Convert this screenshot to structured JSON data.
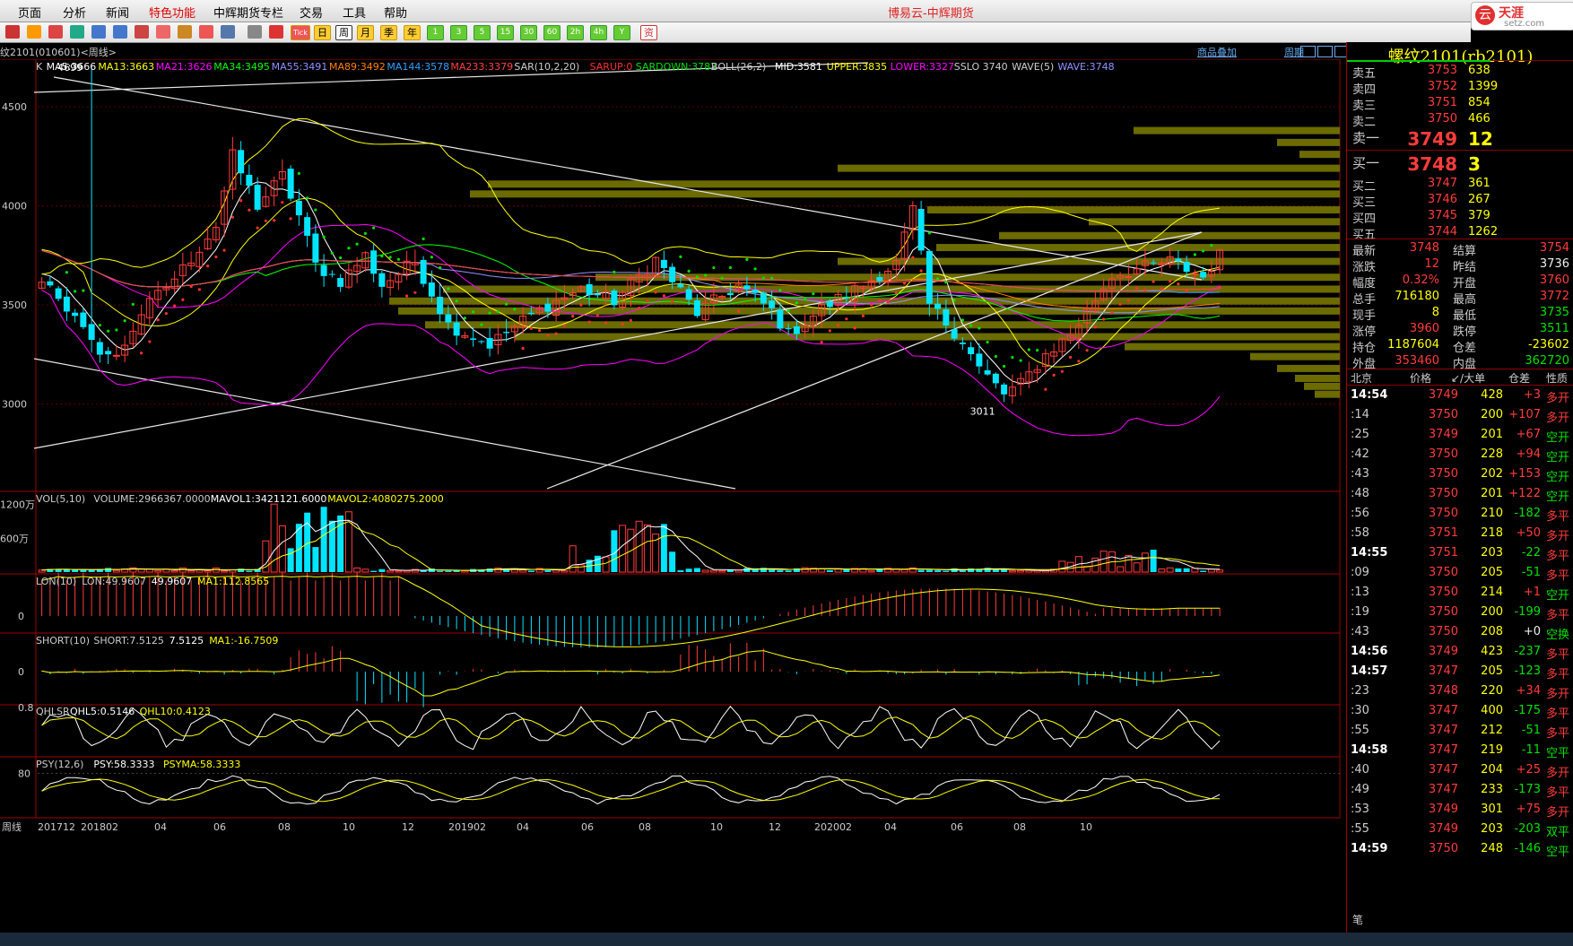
{
  "app": {
    "title": "博易云-中辉期货",
    "menu": [
      "页面",
      "分析",
      "新闻",
      "特色功能",
      "中辉期货专栏",
      "交易",
      "工具",
      "帮助"
    ],
    "menu_hot_index": 3,
    "logo_text": "天涯",
    "logo_sub": "setz.com",
    "toolbar_labels": {
      "week": "周",
      "month": "月",
      "quarter": "季",
      "year": "年",
      "day": "日",
      "tick": "Tick",
      "m1": "1",
      "m3": "3",
      "m5": "5",
      "m15": "15",
      "m30": "30",
      "m60": "60",
      "custom": "2h",
      "hour": "4h",
      "y": "Y",
      "news": "资"
    }
  },
  "chart_header": {
    "breadcrumb": "纹2101(010601)<周线>",
    "product_add": "商品叠加",
    "period_link": "周期"
  },
  "indicators": {
    "main": [
      {
        "t": "K",
        "c": "#ccc"
      },
      {
        "t": "MA5:3666",
        "c": "#ffffff"
      },
      {
        "t": "MA13:3663",
        "c": "#ffff00"
      },
      {
        "t": "MA21:3626",
        "c": "#ff00ff"
      },
      {
        "t": "MA34:3495",
        "c": "#00ff00"
      },
      {
        "t": "MA55:3491",
        "c": "#9090ff"
      },
      {
        "t": "MA89:3492",
        "c": "#ff8000"
      },
      {
        "t": "MA144:3578",
        "c": "#30a0ff"
      },
      {
        "t": "MA233:3379",
        "c": "#ff4040"
      },
      {
        "t": "SAR(10,2,20)",
        "c": "#ccc"
      },
      {
        "t": "SARUP:0",
        "c": "#ff3030"
      },
      {
        "t": "SARDOWN:3782",
        "c": "#00e000"
      },
      {
        "t": "BOLL(26,2)",
        "c": "#ccc"
      },
      {
        "t": "MID:3581",
        "c": "#ffffff"
      },
      {
        "t": "UPPER:3835",
        "c": "#ffff00"
      },
      {
        "t": "LOWER:3327",
        "c": "#ff00ff"
      },
      {
        "t": "SSLO 3740",
        "c": "#ccc"
      },
      {
        "t": "WAVE(5)",
        "c": "#ccc"
      },
      {
        "t": "WAVE:3748",
        "c": "#9090ff"
      }
    ],
    "vol": [
      {
        "t": "VOL(5,10)",
        "c": "#ccc"
      },
      {
        "t": "VOLUME:2966367.0000",
        "c": "#ccc"
      },
      {
        "t": "MAVOL1:3421121.6000",
        "c": "#ffffff"
      },
      {
        "t": "MAVOL2:4080275.2000",
        "c": "#ffff00"
      }
    ],
    "lon": [
      {
        "t": "LON(10)",
        "c": "#ccc"
      },
      {
        "t": "LON:49.9607",
        "c": "#ccc"
      },
      {
        "t": "49.9607",
        "c": "#ffffff"
      },
      {
        "t": "MA1:112.8565",
        "c": "#ffff00"
      }
    ],
    "short": [
      {
        "t": "SHORT(10)",
        "c": "#ccc"
      },
      {
        "t": "SHORT:7.5125",
        "c": "#ccc"
      },
      {
        "t": "7.5125",
        "c": "#ffffff"
      },
      {
        "t": "MA1:-16.7509",
        "c": "#ffff00"
      }
    ],
    "qhlsr": [
      {
        "t": "QHLSR",
        "c": "#ccc"
      },
      {
        "t": "QHL5:0.5146",
        "c": "#ffffff"
      },
      {
        "t": "QHL10:0.4123",
        "c": "#ffff00"
      }
    ],
    "psy": [
      {
        "t": "PSY(12,6)",
        "c": "#ccc"
      },
      {
        "t": "PSY:58.3333",
        "c": "#ffffff"
      },
      {
        "t": "PSYMA:58.3333",
        "c": "#ffff00"
      }
    ]
  },
  "axes": {
    "price_ticks": [
      "4500",
      "4000",
      "3500",
      "3000"
    ],
    "vol_ticks": [
      "1200万",
      "600万"
    ],
    "lon_tick": "0",
    "short_tick": "0",
    "qhlsr_tick": "0.8",
    "psy_tick": "80",
    "x_start_label": "周线",
    "x_labels": [
      "201712",
      "201802",
      "04",
      "06",
      "08",
      "10",
      "12",
      "201902",
      "04",
      "06",
      "08",
      "10",
      "12",
      "202002",
      "04",
      "06",
      "08",
      "10"
    ],
    "max_label": "4699",
    "min_label": "3011"
  },
  "chart_data": {
    "type": "candlestick",
    "period": "weekly",
    "ylim": [
      2560,
      4740
    ],
    "max": 4699,
    "min": 3011,
    "ma_lines": [
      {
        "name": "MA5",
        "color": "#ffffff"
      },
      {
        "name": "MA13",
        "color": "#ffff00"
      },
      {
        "name": "MA21",
        "color": "#ff00ff"
      },
      {
        "name": "MA34",
        "color": "#00ff00"
      },
      {
        "name": "MA55",
        "color": "#9090ff"
      },
      {
        "name": "MA89",
        "color": "#ff8000"
      },
      {
        "name": "MA144",
        "color": "#30a0ff"
      },
      {
        "name": "MA233",
        "color": "#ff4040"
      }
    ],
    "boll_colors": {
      "mid": "#ffffff",
      "upper": "#ffff00",
      "lower": "#ff00ff"
    }
  },
  "quote": {
    "name": "螺纹2101(rb2101)",
    "asks": [
      {
        "label": "卖五",
        "price": "3753",
        "vol": "638"
      },
      {
        "label": "卖四",
        "price": "3752",
        "vol": "1399"
      },
      {
        "label": "卖三",
        "price": "3751",
        "vol": "854"
      },
      {
        "label": "卖二",
        "price": "3750",
        "vol": "466"
      },
      {
        "label": "卖一",
        "price": "3749",
        "vol": "12"
      }
    ],
    "bids": [
      {
        "label": "买一",
        "price": "3748",
        "vol": "3"
      },
      {
        "label": "买二",
        "price": "3747",
        "vol": "361"
      },
      {
        "label": "买三",
        "price": "3746",
        "vol": "267"
      },
      {
        "label": "买四",
        "price": "3745",
        "vol": "379"
      },
      {
        "label": "买五",
        "price": "3744",
        "vol": "1262"
      }
    ],
    "stats": [
      {
        "l1": "最新",
        "v1": "3748",
        "c1": "red",
        "l2": "结算",
        "v2": "3754",
        "c2": "red"
      },
      {
        "l1": "涨跌",
        "v1": "12",
        "c1": "red",
        "l2": "昨结",
        "v2": "3736",
        "c2": "wht"
      },
      {
        "l1": "幅度",
        "v1": "0.32%",
        "c1": "red",
        "l2": "开盘",
        "v2": "3760",
        "c2": "red"
      },
      {
        "l1": "总手",
        "v1": "716180",
        "c1": "yel",
        "l2": "最高",
        "v2": "3772",
        "c2": "red"
      },
      {
        "l1": "现手",
        "v1": "8",
        "c1": "yel",
        "l2": "最低",
        "v2": "3735",
        "c2": "green"
      },
      {
        "l1": "涨停",
        "v1": "3960",
        "c1": "red",
        "l2": "跌停",
        "v2": "3511",
        "c2": "green"
      },
      {
        "l1": "持仓",
        "v1": "1187604",
        "c1": "yel",
        "l2": "仓差",
        "v2": "-23602",
        "c2": "yel"
      },
      {
        "l1": "外盘",
        "v1": "353460",
        "c1": "red",
        "l2": "内盘",
        "v2": "362720",
        "c2": "green"
      }
    ],
    "tick_header": [
      "北京",
      "价格",
      "↙/大单",
      "仓差",
      "性质"
    ],
    "ticks": [
      {
        "t": "14:54",
        "major": true,
        "p": "3749",
        "q": "428",
        "d": "+3",
        "n": "多开",
        "dc": "red",
        "nc": "red"
      },
      {
        "t": ":14",
        "major": false,
        "p": "3750",
        "q": "200",
        "d": "+107",
        "n": "多开",
        "dc": "red",
        "nc": "red"
      },
      {
        "t": ":25",
        "major": false,
        "p": "3749",
        "q": "201",
        "d": "+67",
        "n": "空开",
        "dc": "red",
        "nc": "green"
      },
      {
        "t": ":42",
        "major": false,
        "p": "3750",
        "q": "228",
        "d": "+94",
        "n": "空开",
        "dc": "red",
        "nc": "green"
      },
      {
        "t": ":43",
        "major": false,
        "p": "3750",
        "q": "202",
        "d": "+153",
        "n": "空开",
        "dc": "red",
        "nc": "green"
      },
      {
        "t": ":48",
        "major": false,
        "p": "3750",
        "q": "201",
        "d": "+122",
        "n": "空开",
        "dc": "red",
        "nc": "green"
      },
      {
        "t": ":56",
        "major": false,
        "p": "3750",
        "q": "210",
        "d": "-182",
        "n": "多平",
        "dc": "green",
        "nc": "red"
      },
      {
        "t": ":58",
        "major": false,
        "p": "3751",
        "q": "218",
        "d": "+50",
        "n": "多开",
        "dc": "red",
        "nc": "red"
      },
      {
        "t": "14:55",
        "major": true,
        "p": "3751",
        "q": "203",
        "d": "-22",
        "n": "多平",
        "dc": "green",
        "nc": "red"
      },
      {
        "t": ":09",
        "major": false,
        "p": "3750",
        "q": "205",
        "d": "-51",
        "n": "多平",
        "dc": "green",
        "nc": "red"
      },
      {
        "t": ":13",
        "major": false,
        "p": "3750",
        "q": "214",
        "d": "+1",
        "n": "空开",
        "dc": "red",
        "nc": "green"
      },
      {
        "t": ":19",
        "major": false,
        "p": "3750",
        "q": "200",
        "d": "-199",
        "n": "多平",
        "dc": "green",
        "nc": "red"
      },
      {
        "t": ":43",
        "major": false,
        "p": "3750",
        "q": "208",
        "d": "+0",
        "n": "空换",
        "dc": "wht",
        "nc": "green"
      },
      {
        "t": "14:56",
        "major": true,
        "p": "3749",
        "q": "423",
        "d": "-237",
        "n": "多平",
        "dc": "green",
        "nc": "red"
      },
      {
        "t": "14:57",
        "major": true,
        "p": "3747",
        "q": "205",
        "d": "-123",
        "n": "多平",
        "dc": "green",
        "nc": "red"
      },
      {
        "t": ":23",
        "major": false,
        "p": "3748",
        "q": "220",
        "d": "+34",
        "n": "多开",
        "dc": "red",
        "nc": "red"
      },
      {
        "t": ":30",
        "major": false,
        "p": "3747",
        "q": "400",
        "d": "-175",
        "n": "多平",
        "dc": "green",
        "nc": "red"
      },
      {
        "t": ":55",
        "major": false,
        "p": "3747",
        "q": "212",
        "d": "-51",
        "n": "多平",
        "dc": "green",
        "nc": "red"
      },
      {
        "t": "14:58",
        "major": true,
        "p": "3747",
        "q": "219",
        "d": "-11",
        "n": "空平",
        "dc": "green",
        "nc": "green"
      },
      {
        "t": ":40",
        "major": false,
        "p": "3747",
        "q": "204",
        "d": "+25",
        "n": "多开",
        "dc": "red",
        "nc": "red"
      },
      {
        "t": ":49",
        "major": false,
        "p": "3747",
        "q": "233",
        "d": "-173",
        "n": "多平",
        "dc": "green",
        "nc": "red"
      },
      {
        "t": ":53",
        "major": false,
        "p": "3749",
        "q": "301",
        "d": "+75",
        "n": "多开",
        "dc": "red",
        "nc": "red"
      },
      {
        "t": ":55",
        "major": false,
        "p": "3749",
        "q": "203",
        "d": "-203",
        "n": "双平",
        "dc": "green",
        "nc": "green"
      },
      {
        "t": "14:59",
        "major": true,
        "p": "3750",
        "q": "248",
        "d": "-146",
        "n": "空平",
        "dc": "green",
        "nc": "green"
      }
    ],
    "footer_label": "笔"
  }
}
